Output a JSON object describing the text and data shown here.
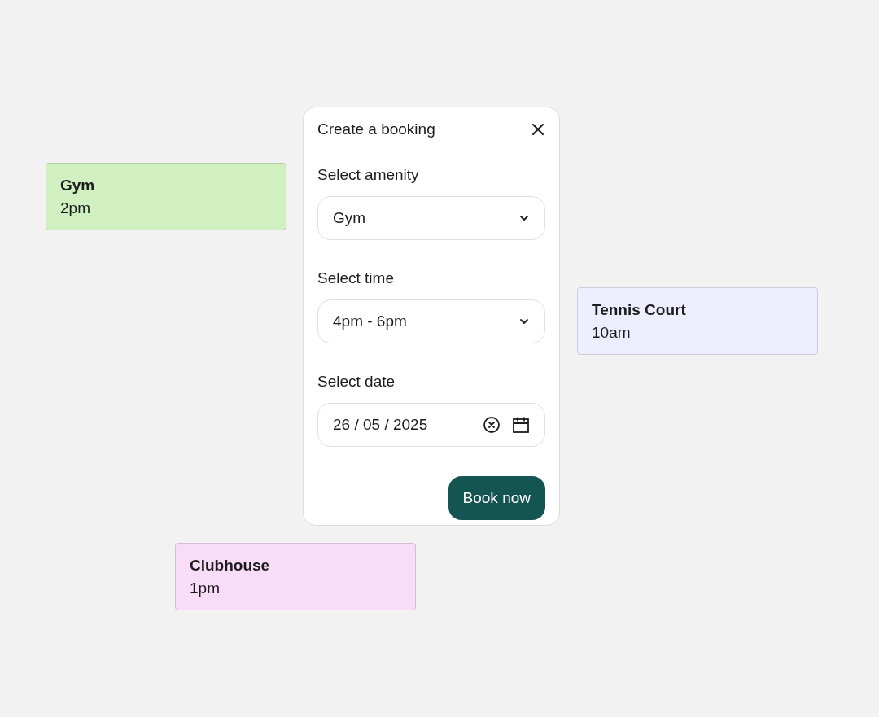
{
  "events": [
    {
      "title": "Gym",
      "time": "2pm",
      "color": "#d1f0c2"
    },
    {
      "title": "Tennis Court",
      "time": "10am",
      "color": "#eceefe"
    },
    {
      "title": "Clubhouse",
      "time": "1pm",
      "color": "#f8dcf8"
    }
  ],
  "dialog": {
    "title": "Create a booking",
    "fields": [
      {
        "kind": "select",
        "label": "Select amenity",
        "value": "Gym"
      },
      {
        "kind": "select",
        "label": "Select time",
        "value": "4pm - 6pm"
      },
      {
        "kind": "date",
        "label": "Select date",
        "value": "26 / 05 / 2025"
      }
    ],
    "submit": "Book now"
  }
}
